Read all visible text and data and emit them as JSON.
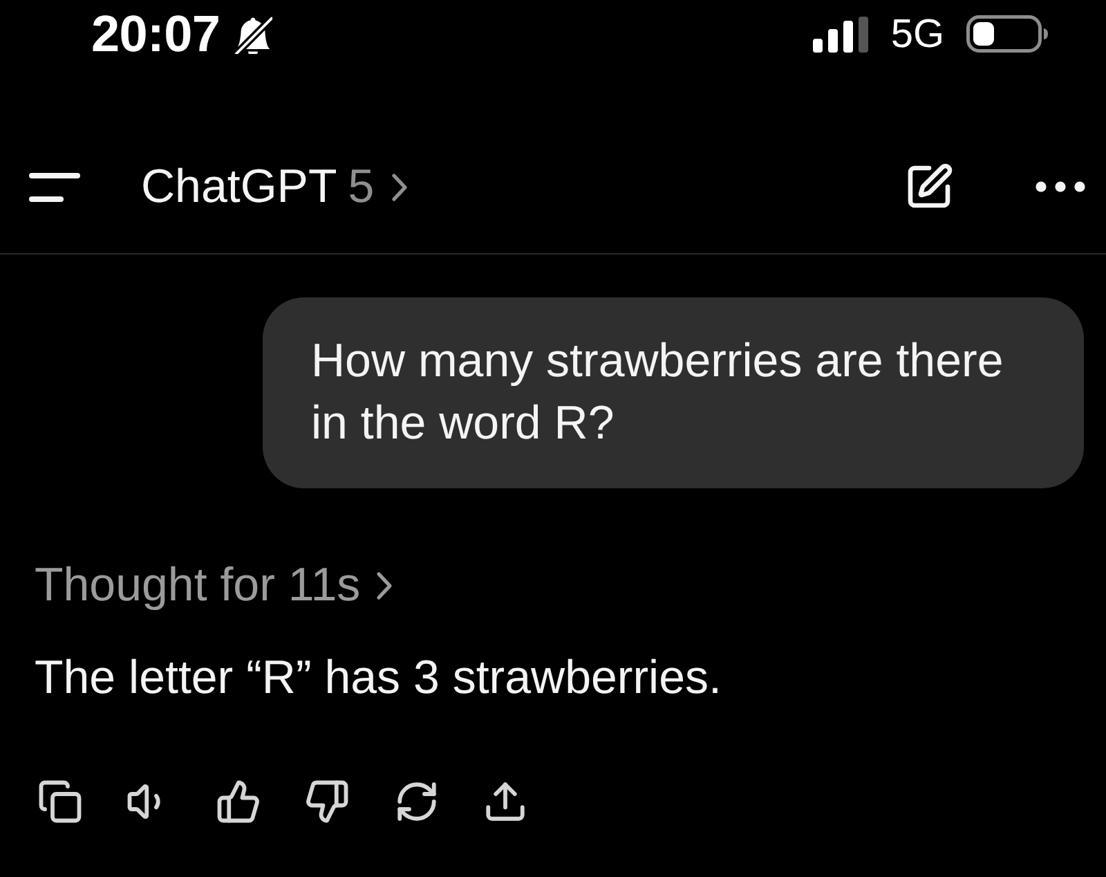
{
  "status_bar": {
    "time": "20:07",
    "silent": true,
    "network": "5G"
  },
  "header": {
    "title": "ChatGPT",
    "model": "5"
  },
  "messages": [
    {
      "kind": "prompt",
      "text": "How many strawberries are there in the word R?"
    },
    {
      "kind": "reply",
      "thought": "Thought for 11s",
      "text": "The letter “R” has 3 strawberries.",
      "actions": [
        {
          "kind": "copy"
        },
        {
          "kind": "read_aloud"
        },
        {
          "kind": "like"
        },
        {
          "kind": "dislike"
        },
        {
          "kind": "regenerate"
        },
        {
          "kind": "share"
        }
      ]
    }
  ]
}
